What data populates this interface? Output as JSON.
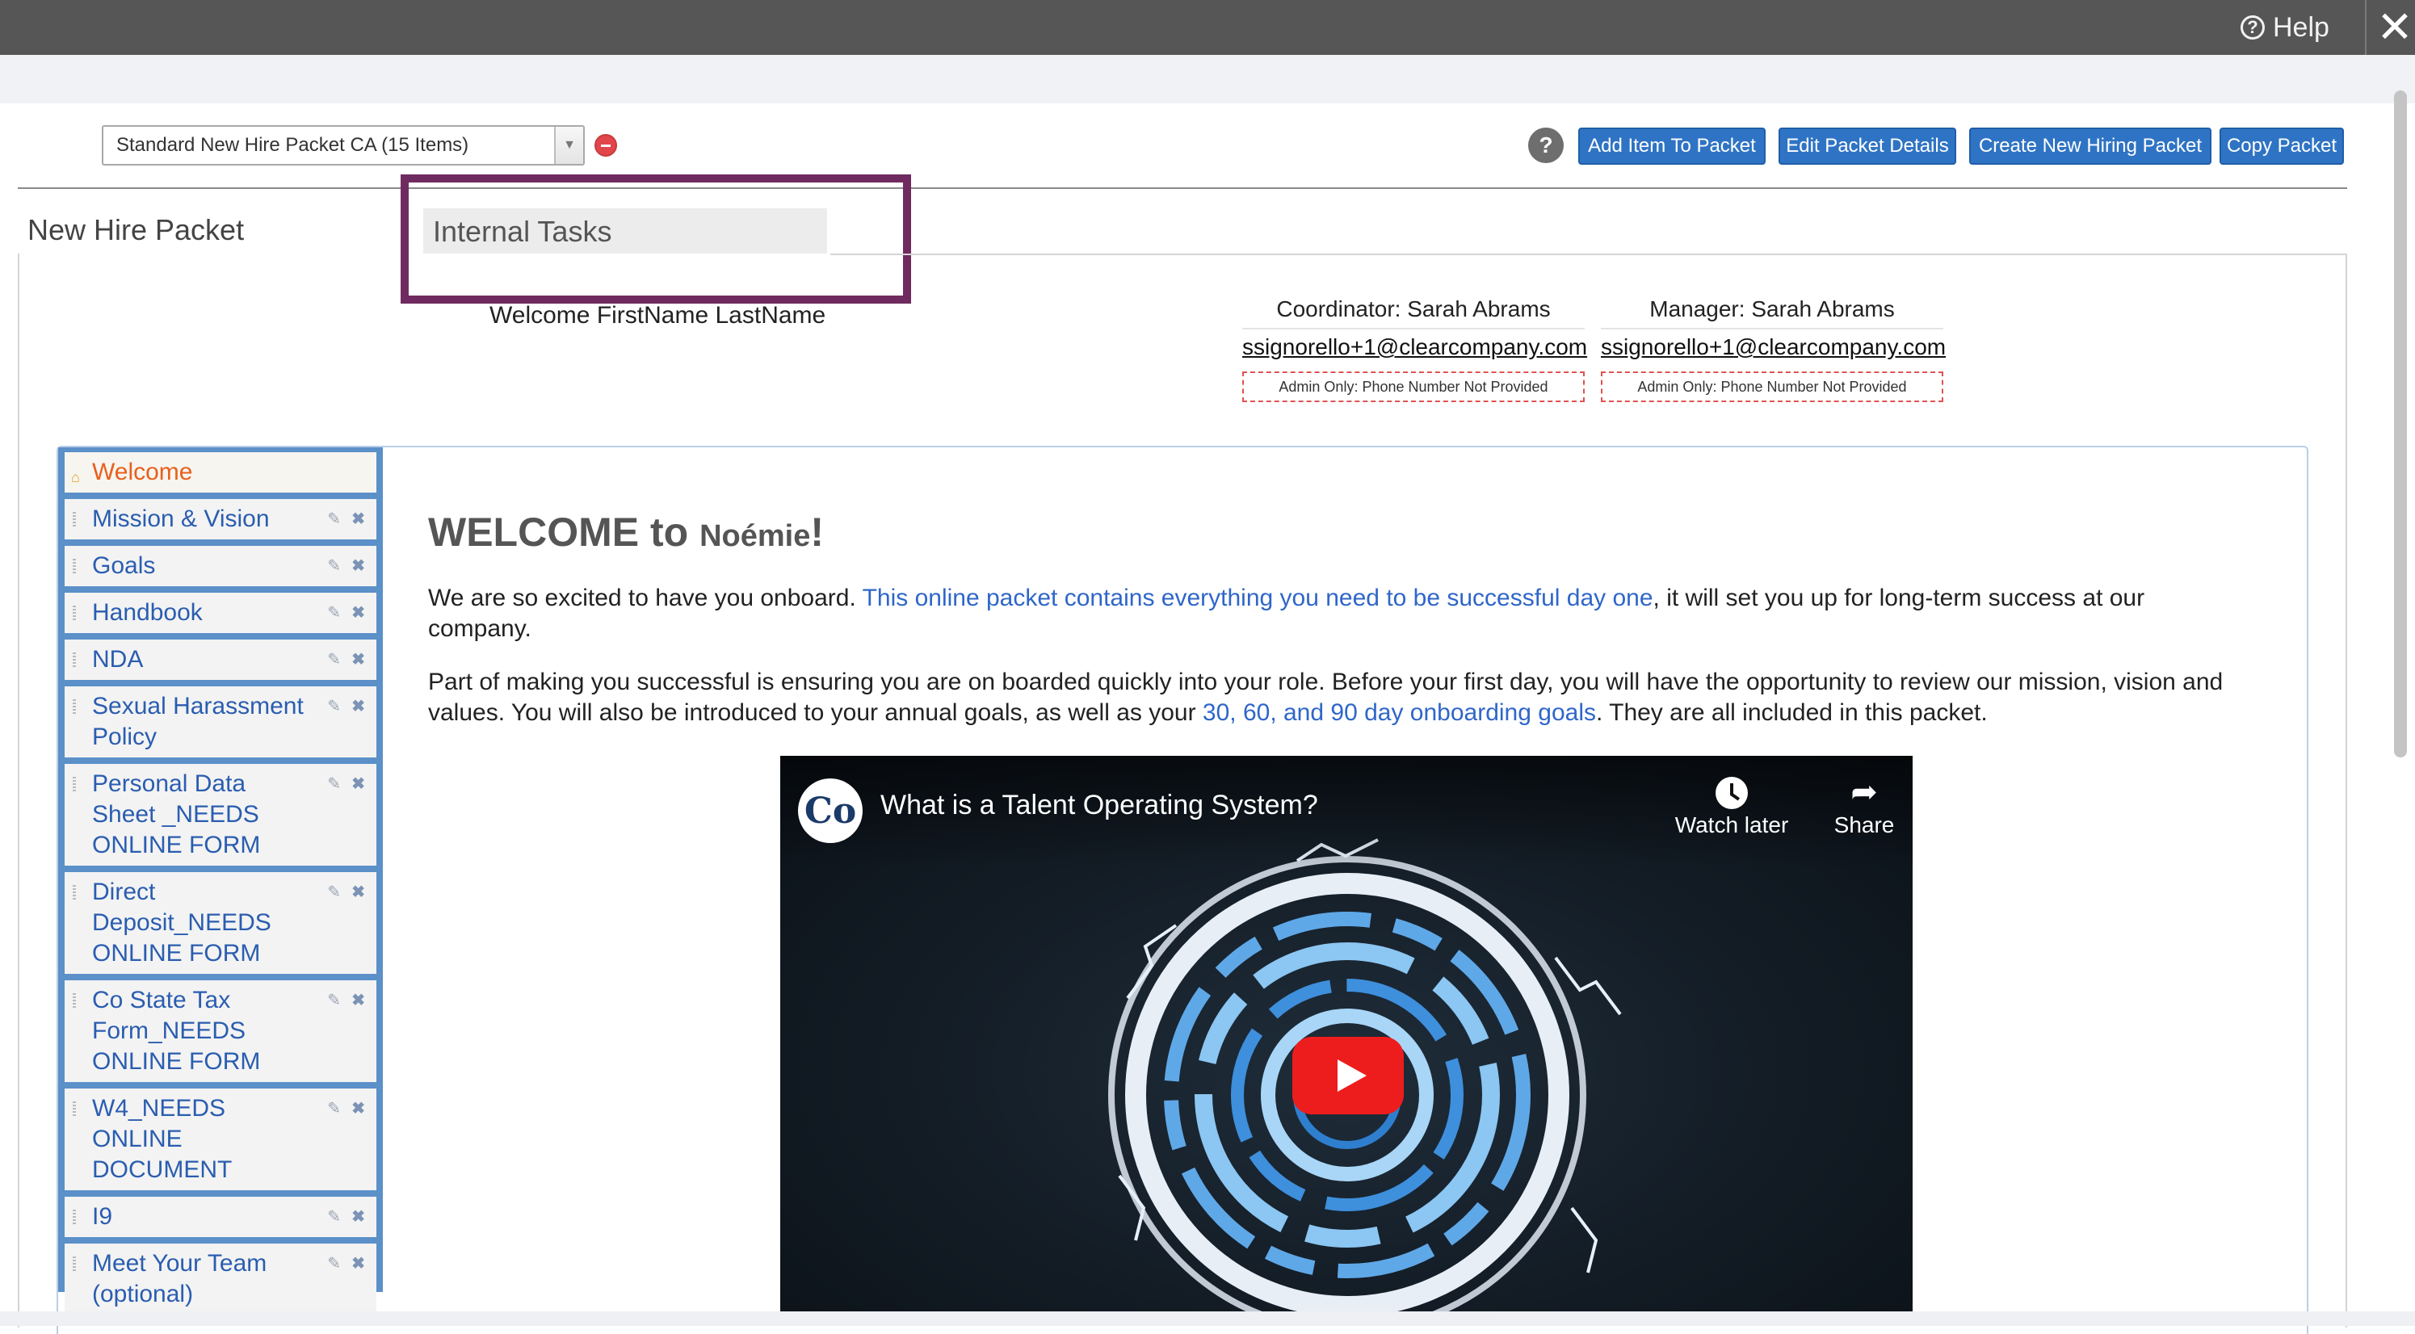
{
  "topbar": {
    "help_label": "Help",
    "close_glyph": "✕"
  },
  "toolbar": {
    "packet_select_value": "Standard New Hire Packet CA (15 Items)",
    "help_glyph": "?",
    "buttons": [
      "Add Item To Packet",
      "Edit Packet Details",
      "Create New Hiring Packet",
      "Copy Packet"
    ]
  },
  "tabs": {
    "new_hire": "New Hire Packet",
    "internal": "Internal Tasks"
  },
  "welcome_name": "Welcome FirstName LastName",
  "coordinator": {
    "role": "Coordinator: Sarah Abrams",
    "email": "ssignorello+1@clearcompany.com",
    "phone": "Admin Only: Phone Number Not Provided"
  },
  "manager": {
    "role": "Manager: Sarah Abrams",
    "email": "ssignorello+1@clearcompany.com",
    "phone": "Admin Only: Phone Number Not Provided"
  },
  "sidebar": {
    "items": [
      {
        "label": "Welcome"
      },
      {
        "label": "Mission & Vision"
      },
      {
        "label": "Goals"
      },
      {
        "label": "Handbook"
      },
      {
        "label": "NDA"
      },
      {
        "label": "Sexual Harassment Policy"
      },
      {
        "label": "Personal Data Sheet _NEEDS ONLINE FORM"
      },
      {
        "label": "Direct Deposit_NEEDS ONLINE FORM"
      },
      {
        "label": "Co State Tax Form_NEEDS ONLINE FORM"
      },
      {
        "label": "W4_NEEDS ONLINE DOCUMENT"
      },
      {
        "label": "I9"
      },
      {
        "label": "Meet Your Team (optional)"
      }
    ]
  },
  "content": {
    "headline_prefix": "WELCOME to ",
    "headline_name": "Noémie",
    "headline_suffix": "!",
    "para1_a": "We are so excited to have you onboard. ",
    "para1_link": "This online packet contains everything you need to be successful day one",
    "para1_b": ", it will set you up for long-term success at our company.",
    "para2_a": "Part of making you successful is ensuring you are on boarded quickly into your role. Before your first day, you will have the opportunity to review our mission, vision and values. You will also be introduced to your annual goals, as well as your ",
    "para2_link": "30, 60, and 90 day onboarding goals",
    "para2_b": ". They are all included in this packet."
  },
  "video": {
    "channel_initials": "Co",
    "title": "What is a Talent Operating System?",
    "watch_later": "Watch later",
    "share": "Share"
  },
  "colors": {
    "topbar": "#565656",
    "highlight_border": "#6f2b5f",
    "sidebar_bg": "#5b90c9",
    "link_blue": "#2f66c9",
    "active_item": "#e8601c",
    "button_blue": "#2f74c4",
    "play_red": "#ee1d1d"
  }
}
